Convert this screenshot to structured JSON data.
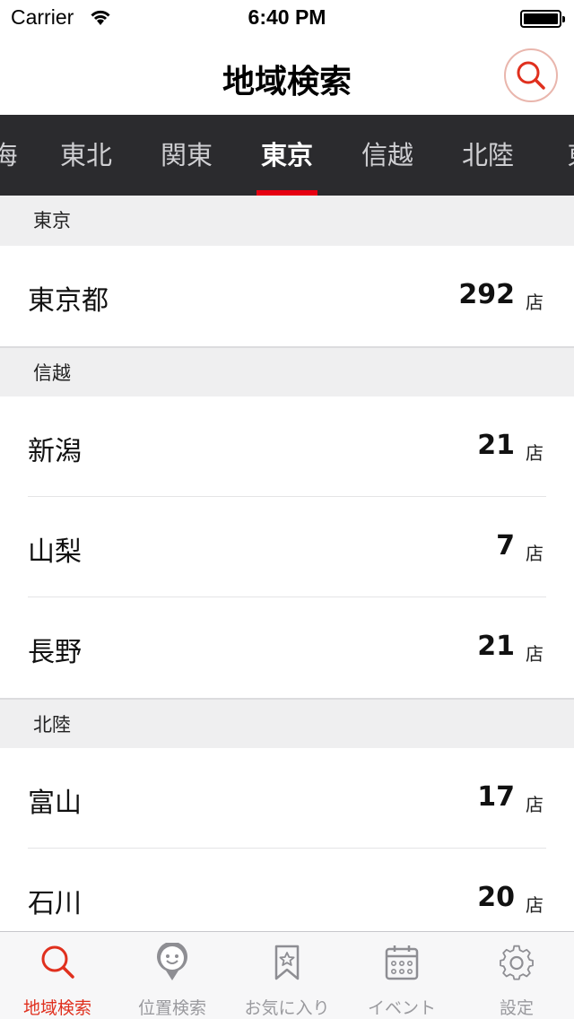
{
  "status_bar": {
    "carrier": "Carrier",
    "time": "6:40 PM"
  },
  "nav": {
    "title": "地域検索",
    "search_icon": "search-icon"
  },
  "region_tabs": {
    "items": [
      {
        "label": "海",
        "active": false
      },
      {
        "label": "東北",
        "active": false
      },
      {
        "label": "関東",
        "active": false
      },
      {
        "label": "東京",
        "active": true
      },
      {
        "label": "信越",
        "active": false
      },
      {
        "label": "北陸",
        "active": false
      },
      {
        "label": "東",
        "active": false
      }
    ],
    "indicator_color": "#e60012"
  },
  "sections": [
    {
      "header": "東京",
      "rows": [
        {
          "name": "東京都",
          "count": "292",
          "unit": "店"
        }
      ]
    },
    {
      "header": "信越",
      "rows": [
        {
          "name": "新潟",
          "count": "21",
          "unit": "店"
        },
        {
          "name": "山梨",
          "count": "7",
          "unit": "店"
        },
        {
          "name": "長野",
          "count": "21",
          "unit": "店"
        }
      ]
    },
    {
      "header": "北陸",
      "rows": [
        {
          "name": "富山",
          "count": "17",
          "unit": "店"
        },
        {
          "name": "石川",
          "count": "20",
          "unit": "店"
        }
      ]
    }
  ],
  "tab_bar": {
    "items": [
      {
        "label": "地域検索",
        "icon": "search-icon",
        "active": true
      },
      {
        "label": "位置検索",
        "icon": "location-pin-icon",
        "active": false
      },
      {
        "label": "お気に入り",
        "icon": "bookmark-star-icon",
        "active": false
      },
      {
        "label": "イベント",
        "icon": "calendar-icon",
        "active": false
      },
      {
        "label": "設定",
        "icon": "gear-icon",
        "active": false
      }
    ],
    "active_color": "#e0301e",
    "inactive_color": "#9a9a9e"
  }
}
